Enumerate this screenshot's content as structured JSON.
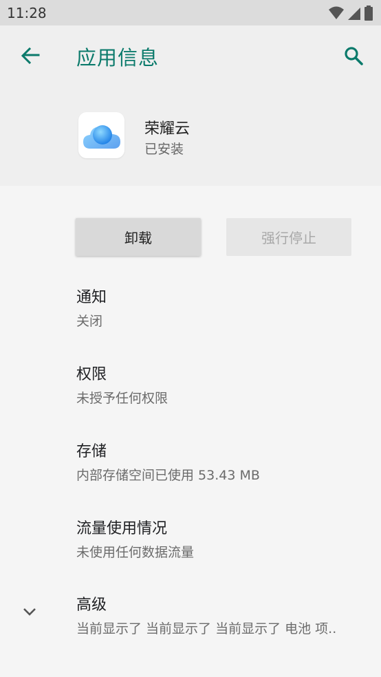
{
  "status_bar": {
    "time": "11:28",
    "icons": [
      "wifi-icon",
      "cell-signal-icon",
      "battery-icon"
    ]
  },
  "app_bar": {
    "title": "应用信息",
    "back_icon": "arrow-back-icon",
    "search_icon": "search-icon",
    "accent_color": "#0b7a6b"
  },
  "app": {
    "name": "荣耀云",
    "status": "已安装",
    "icon": "cloud-app-icon"
  },
  "buttons": {
    "uninstall": "卸载",
    "force_stop": "强行停止"
  },
  "settings": [
    {
      "title": "通知",
      "summary": "关闭"
    },
    {
      "title": "权限",
      "summary": "未授予任何权限"
    },
    {
      "title": "存储",
      "summary": "内部存储空间已使用 53.43 MB"
    },
    {
      "title": "流量使用情况",
      "summary": "未使用任何数据流量"
    },
    {
      "title": "高级",
      "summary": "当前显示了 当前显示了 当前显示了 电池 项.."
    }
  ]
}
